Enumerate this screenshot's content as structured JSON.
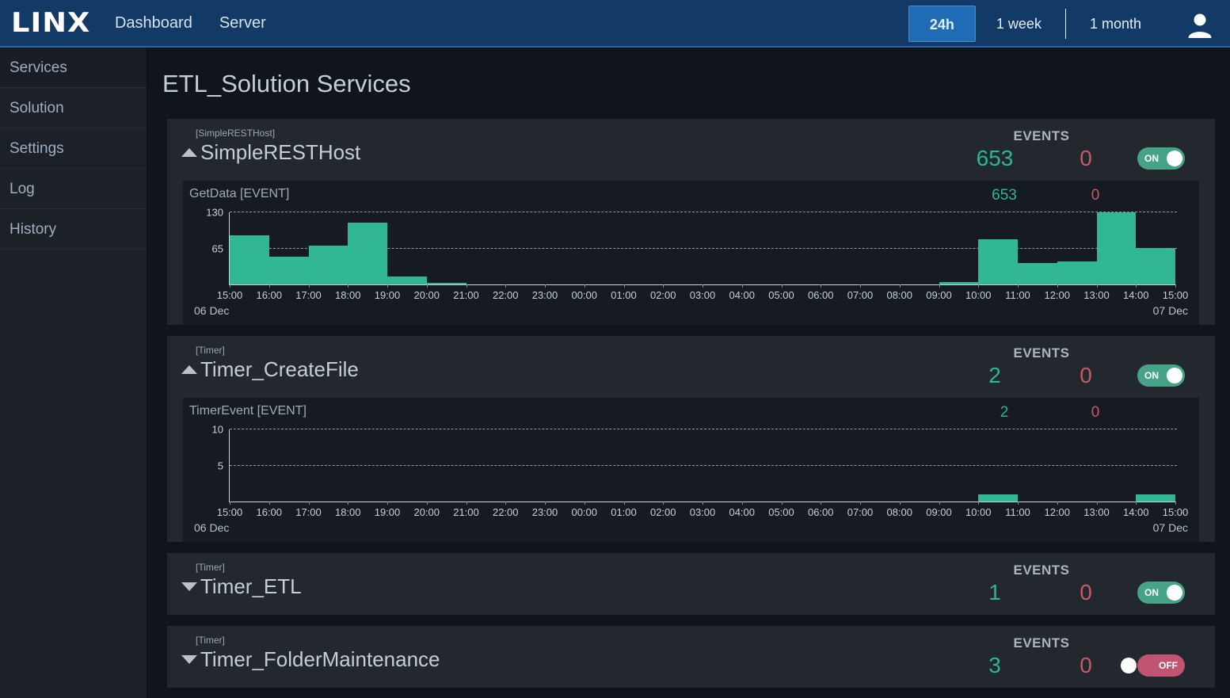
{
  "header": {
    "logo": "LINX",
    "nav": [
      {
        "label": "Dashboard"
      },
      {
        "label": "Server"
      }
    ],
    "ranges": [
      {
        "label": "24h",
        "active": true
      },
      {
        "label": "1 week",
        "active": false
      },
      {
        "label": "1 month",
        "active": false
      }
    ],
    "avatar_icon": "user-avatar-icon",
    "accent": "#1f6cb5"
  },
  "sidebar": {
    "items": [
      {
        "label": "Services",
        "active": true
      },
      {
        "label": "Solution",
        "active": false
      },
      {
        "label": "Settings",
        "active": false
      },
      {
        "label": "Log",
        "active": false
      },
      {
        "label": "History",
        "active": false
      }
    ]
  },
  "main": {
    "title": "ETL_Solution Services",
    "events_label": "EVENTS",
    "colors": {
      "ok": "#2bb793",
      "error": "#c8596b",
      "bar": "#32b794",
      "toggle_on": "#47a388",
      "toggle_off": "#bf5571"
    },
    "services": [
      {
        "type": "[SimpleRESTHost]",
        "name": "SimpleRESTHost",
        "expanded": true,
        "caret": "caret-up-icon",
        "events_ok": "653",
        "events_error": "0",
        "toggle": "ON",
        "toggle_state": "on",
        "chart": {
          "name": "GetData [EVENT]",
          "events_ok": "653",
          "events_error": "0",
          "date_start": "06 Dec",
          "date_end": "07 Dec"
        }
      },
      {
        "type": "[Timer]",
        "name": "Timer_CreateFile",
        "expanded": true,
        "caret": "caret-up-icon",
        "events_ok": "2",
        "events_error": "0",
        "toggle": "ON",
        "toggle_state": "on",
        "chart": {
          "name": "TimerEvent [EVENT]",
          "events_ok": "2",
          "events_error": "0",
          "date_start": "06 Dec",
          "date_end": "07 Dec"
        }
      },
      {
        "type": "[Timer]",
        "name": "Timer_ETL",
        "expanded": false,
        "caret": "caret-down-icon",
        "events_ok": "1",
        "events_error": "0",
        "toggle": "ON",
        "toggle_state": "on",
        "chart": null
      },
      {
        "type": "[Timer]",
        "name": "Timer_FolderMaintenance",
        "expanded": false,
        "caret": "caret-down-icon",
        "events_ok": "3",
        "events_error": "0",
        "toggle": "OFF",
        "toggle_state": "off",
        "chart": null
      }
    ]
  },
  "chart_data": [
    {
      "type": "bar",
      "title": "GetData [EVENT]",
      "xlabel": "",
      "ylabel": "",
      "ylim": [
        0,
        130
      ],
      "yticks": [
        65,
        130
      ],
      "grid": true,
      "legend": null,
      "categories": [
        "15:00",
        "16:00",
        "17:00",
        "18:00",
        "19:00",
        "20:00",
        "21:00",
        "22:00",
        "23:00",
        "00:00",
        "01:00",
        "02:00",
        "03:00",
        "04:00",
        "05:00",
        "06:00",
        "07:00",
        "08:00",
        "09:00",
        "10:00",
        "11:00",
        "12:00",
        "13:00",
        "14:00"
      ],
      "values": [
        88,
        50,
        70,
        112,
        14,
        3,
        0,
        0,
        0,
        0,
        0,
        0,
        0,
        0,
        0,
        0,
        0,
        0,
        5,
        82,
        38,
        42,
        130,
        66
      ],
      "xtick_labels": [
        "15:00",
        "16:00",
        "17:00",
        "18:00",
        "19:00",
        "20:00",
        "21:00",
        "22:00",
        "23:00",
        "00:00",
        "01:00",
        "02:00",
        "03:00",
        "04:00",
        "05:00",
        "06:00",
        "07:00",
        "08:00",
        "09:00",
        "10:00",
        "11:00",
        "12:00",
        "13:00",
        "14:00",
        "15:00"
      ],
      "annotations": {
        "left_date": "06 Dec",
        "right_date": "07 Dec"
      }
    },
    {
      "type": "bar",
      "title": "TimerEvent [EVENT]",
      "xlabel": "",
      "ylabel": "",
      "ylim": [
        0,
        10
      ],
      "yticks": [
        5,
        10
      ],
      "grid": true,
      "legend": null,
      "categories": [
        "15:00",
        "16:00",
        "17:00",
        "18:00",
        "19:00",
        "20:00",
        "21:00",
        "22:00",
        "23:00",
        "00:00",
        "01:00",
        "02:00",
        "03:00",
        "04:00",
        "05:00",
        "06:00",
        "07:00",
        "08:00",
        "09:00",
        "10:00",
        "11:00",
        "12:00",
        "13:00",
        "14:00"
      ],
      "values": [
        0,
        0,
        0,
        0,
        0,
        0,
        0,
        0,
        0,
        0,
        0,
        0,
        0,
        0,
        0,
        0,
        0,
        0,
        0,
        1,
        0,
        0,
        0,
        1
      ],
      "xtick_labels": [
        "15:00",
        "16:00",
        "17:00",
        "18:00",
        "19:00",
        "20:00",
        "21:00",
        "22:00",
        "23:00",
        "00:00",
        "01:00",
        "02:00",
        "03:00",
        "04:00",
        "05:00",
        "06:00",
        "07:00",
        "08:00",
        "09:00",
        "10:00",
        "11:00",
        "12:00",
        "13:00",
        "14:00",
        "15:00"
      ],
      "annotations": {
        "left_date": "06 Dec",
        "right_date": "07 Dec"
      }
    }
  ]
}
